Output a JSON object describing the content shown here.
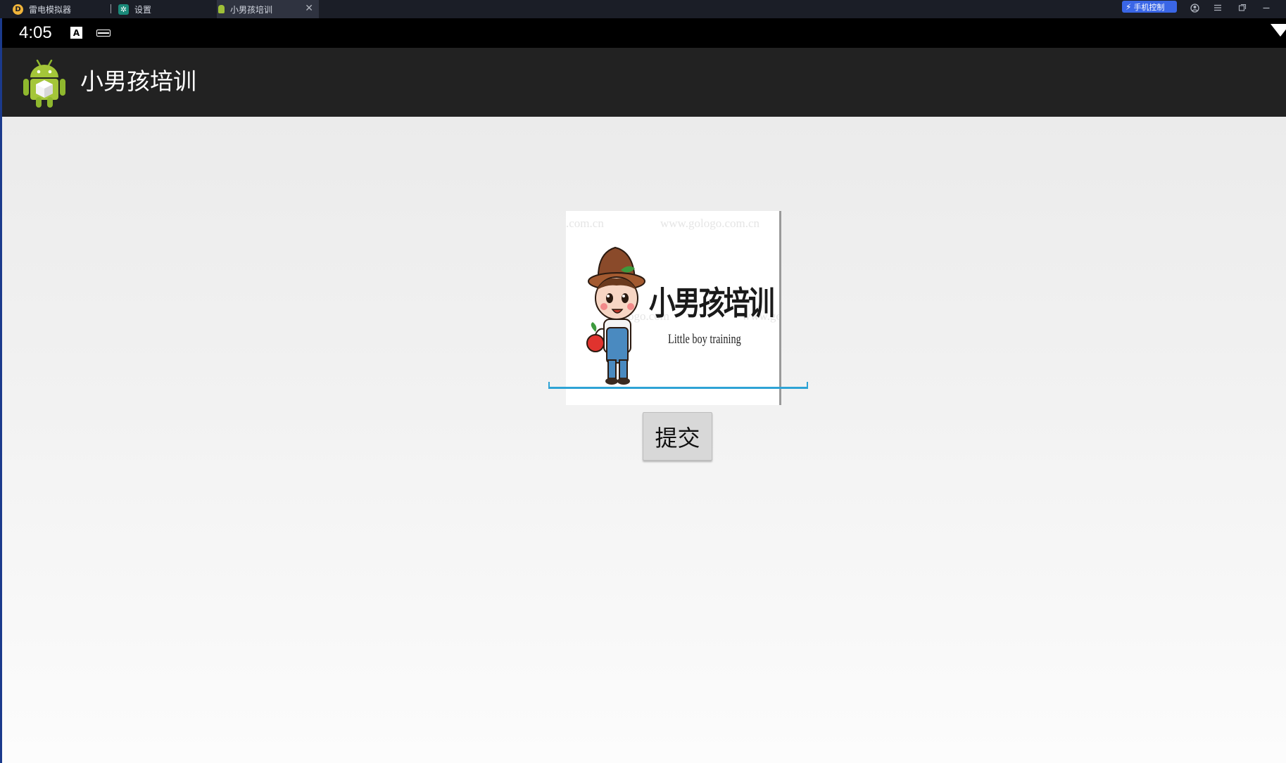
{
  "emulator": {
    "tabs": [
      {
        "label": "雷电模拟器",
        "icon": "ldplayer-logo-icon"
      },
      {
        "label": "设置",
        "icon": "settings-gear-icon"
      },
      {
        "label": "小男孩培训",
        "icon": "android-app-icon",
        "active": true
      }
    ],
    "phone_control_label": "手机控制",
    "window_controls": [
      "account-icon",
      "menu-icon",
      "restore-icon",
      "minimize-icon"
    ]
  },
  "status_bar": {
    "time": "4:05",
    "icons": [
      "text-input-indicator-icon",
      "keyboard-icon",
      "wifi-icon"
    ]
  },
  "action_bar": {
    "title": "小男孩培训",
    "icon": "android-launcher-icon"
  },
  "logo_image": {
    "title_cn": "小男孩培训",
    "title_en": "Little boy training",
    "watermarks": [
      ".com.cn",
      "www.gologo.com.cn",
      "ogo.com",
      "www.gol"
    ]
  },
  "form": {
    "input_value": "",
    "submit_label": "提交"
  },
  "colors": {
    "action_bar_bg": "#222222",
    "input_underline": "#2ea3d5",
    "button_bg": "#d8d8d8",
    "phone_control_bg": "#3a66e6"
  }
}
